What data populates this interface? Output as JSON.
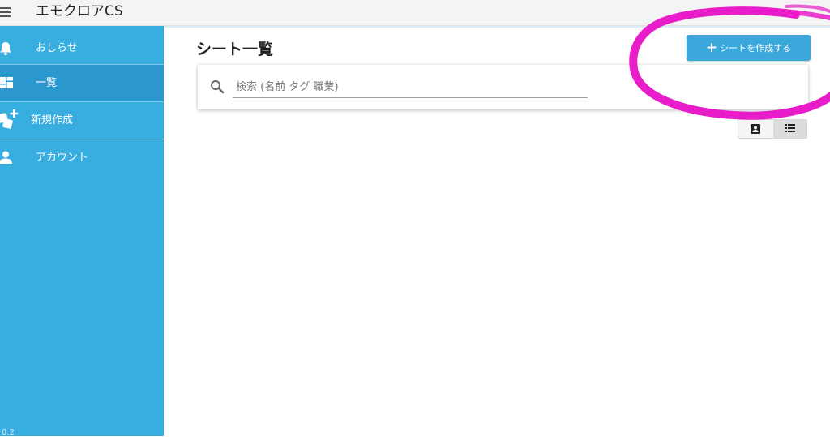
{
  "app": {
    "title": "エモクロアCS"
  },
  "sidebar": {
    "items": [
      {
        "label": "おしらせ",
        "icon": "bell-icon",
        "active": false
      },
      {
        "label": "一覧",
        "icon": "dashboard-icon",
        "active": true
      },
      {
        "label": "新規作成",
        "icon": "dice-add-icon",
        "active": false
      },
      {
        "label": "アカウント",
        "icon": "person-icon",
        "active": false
      }
    ],
    "version": "0.2"
  },
  "main": {
    "title": "シート一覧",
    "create_button": {
      "plus": "+",
      "label": "シートを作成する"
    },
    "search": {
      "placeholder": "検索 (名前 タグ 職業)",
      "icon": "search-icon"
    },
    "view_toggle": {
      "options": [
        {
          "icon": "contact-card-icon",
          "selected": false
        },
        {
          "icon": "list-icon",
          "selected": true
        }
      ]
    }
  },
  "colors": {
    "sidebar": "#38ade0",
    "sidebar_active": "#2b99cf",
    "button": "#3aa8db",
    "annotation": "#e81cc8"
  },
  "annotation": {
    "shape": "hand-drawn circle",
    "color": "#e81cc8",
    "target": "create-sheet-button"
  }
}
